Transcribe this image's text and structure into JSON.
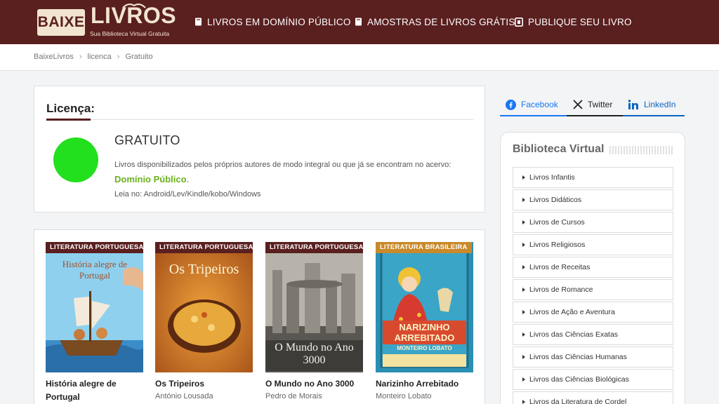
{
  "header": {
    "logo_badge": "BAIXE",
    "logo_word": "LIVROS",
    "logo_tagline": "Sua Biblioteca Virtual Gratuita",
    "nav": [
      "LIVROS EM DOMÍNIO PÚBLICO",
      "AMOSTRAS DE LIVROS GRÁTIS",
      "PUBLIQUE SEU LIVRO"
    ]
  },
  "breadcrumb": [
    "BaixeLivros",
    "licenca",
    "Gratuito"
  ],
  "license": {
    "heading": "Licença:",
    "name": "GRATUITO",
    "color": "#22e01e",
    "description": "Livros disponibilizados pelos próprios autores de modo integral ou que já se encontram no acervo:",
    "link": "Domínio Público",
    "link_suffix": ".",
    "read_on": "Leia no: Android/Lev/Kindle/kobo/Windows"
  },
  "books": [
    {
      "category": "LITERATURA PORTUGUESA",
      "title": "História alegre de Portugal",
      "author": "",
      "cover_text": "História alegre de Portugal"
    },
    {
      "category": "LITERATURA PORTUGUESA",
      "title": "Os Tripeiros",
      "author": "António Lousada",
      "cover_text": "Os Tripeiros"
    },
    {
      "category": "LITERATURA PORTUGUESA",
      "title": "O Mundo no Ano 3000",
      "author": "Pedro de Morais",
      "cover_text": "O Mundo no Ano 3000"
    },
    {
      "category": "LITERATURA BRASILEIRA",
      "title": "Narizinho Arrebitado",
      "author": "Monteiro Lobato",
      "cover_text": "Narizinho Arrebitado",
      "cover_author": "MONTEIRO LOBATO"
    }
  ],
  "social": {
    "facebook": "Facebook",
    "twitter": "Twitter",
    "linkedin": "LinkedIn"
  },
  "sidebar": {
    "title": "Biblioteca Virtual",
    "categories": [
      "Livros Infantis",
      "Livros Didáticos",
      "Livros de Cursos",
      "Livros Religiosos",
      "Livros de Receitas",
      "Livros de Romance",
      "Livros de Ação e Aventura",
      "Livros das Ciências Exatas",
      "Livros das Ciências Humanas",
      "Livros das Ciências Biológicas",
      "Livros da Literatura de Cordel"
    ]
  },
  "colors": {
    "brand": "#5a1f1f",
    "accent_green": "#6bb11f",
    "facebook": "#1877f2",
    "linkedin": "#0a66c2"
  }
}
